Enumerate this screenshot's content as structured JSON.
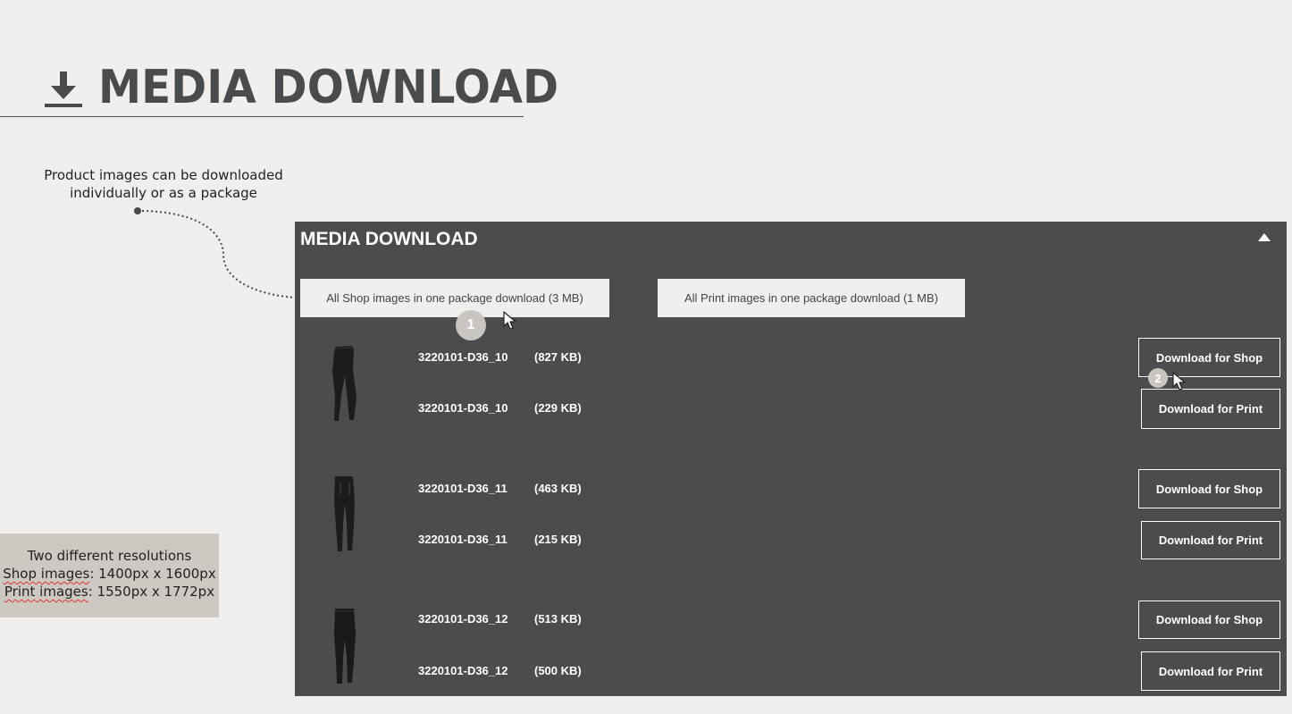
{
  "page_title": "MEDIA DOWNLOAD",
  "note": {
    "line1": "Product images can be downloaded",
    "line2": "individually or as a package"
  },
  "resolutions": {
    "line1": "Two different resolutions",
    "shop_label": "Shop images",
    "shop_value": ": 1400px x 1600px",
    "print_label": "Print images",
    "print_value": ": 1550px x 1772px"
  },
  "panel": {
    "title": "MEDIA DOWNLOAD",
    "package_shop": "All Shop images in one package download (3 MB)",
    "package_print": "All Print images in one package download (1 MB)",
    "products": [
      {
        "shop": {
          "name": "3220101-D36_10",
          "size": "(827 KB)",
          "button": "Download for Shop"
        },
        "print": {
          "name": "3220101-D36_10",
          "size": "(229 KB)",
          "button": "Download for Print"
        }
      },
      {
        "shop": {
          "name": "3220101-D36_11",
          "size": "(463 KB)",
          "button": "Download for Shop"
        },
        "print": {
          "name": "3220101-D36_11",
          "size": "(215 KB)",
          "button": "Download for Print"
        }
      },
      {
        "shop": {
          "name": "3220101-D36_12",
          "size": "(513 KB)",
          "button": "Download for Shop"
        },
        "print": {
          "name": "3220101-D36_12",
          "size": "(500 KB)",
          "button": "Download for Print"
        }
      }
    ]
  },
  "badges": [
    "1",
    "2"
  ],
  "icons": {
    "title": "download-icon",
    "collapse": "triangle-up-icon",
    "cursor": "mouse-pointer-icon"
  },
  "colors": {
    "background": "#f0efed",
    "panel": "#4b4c4e",
    "title": "#4a4b4d",
    "resolution_box": "#cdc9c2",
    "badge": "#c9c6c1"
  }
}
